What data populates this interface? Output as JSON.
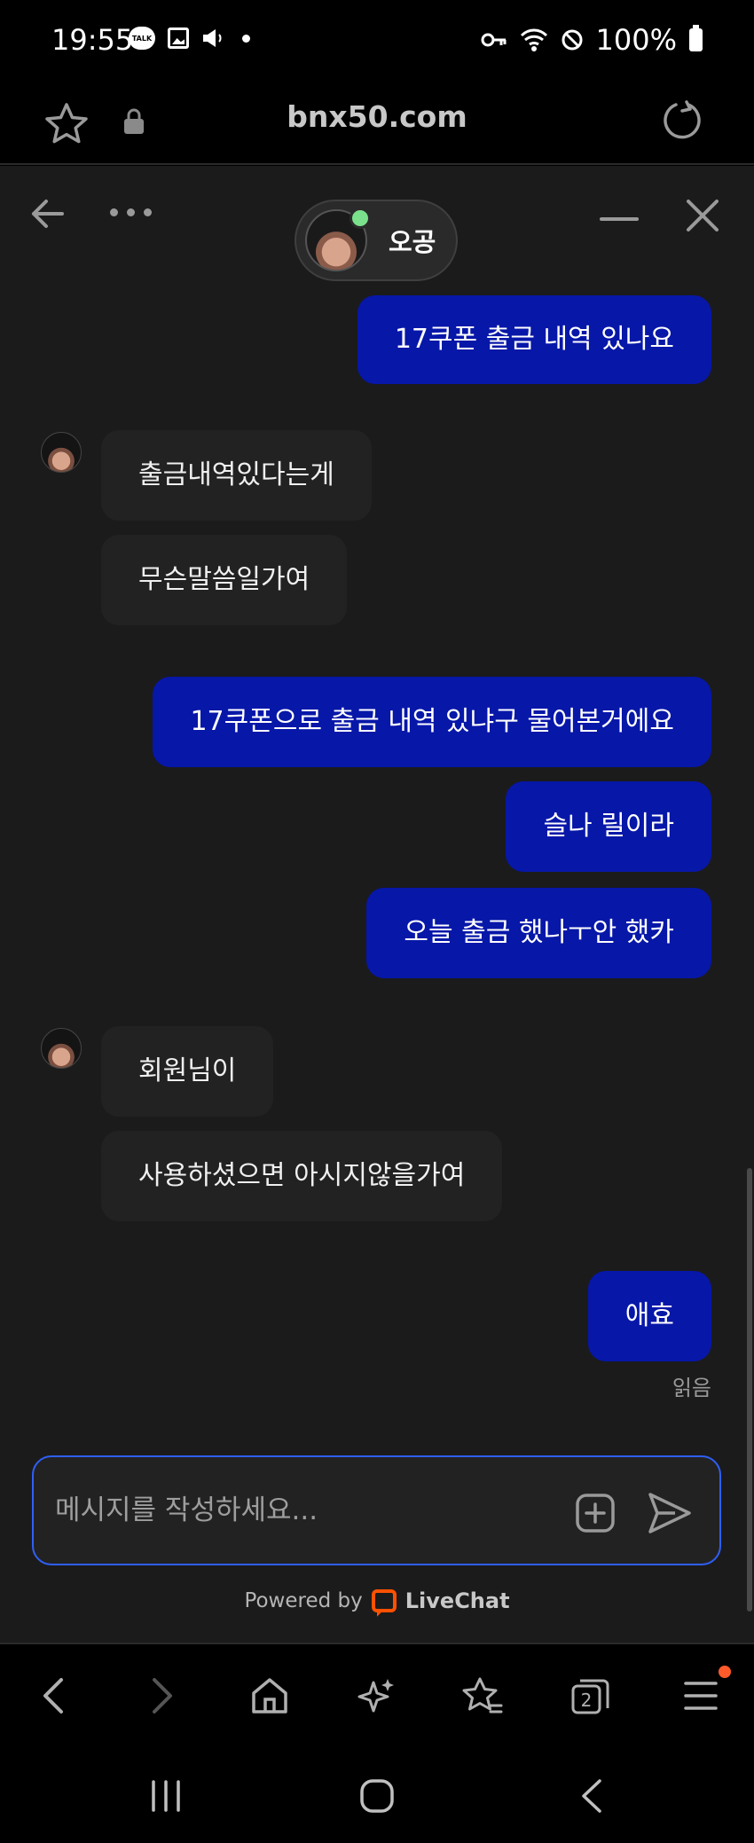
{
  "status_bar": {
    "time": "19:55",
    "talk_badge": "TALK",
    "battery": "100%"
  },
  "browser": {
    "url": "bnx50.com"
  },
  "chat": {
    "agent_name": "오공",
    "messages": [
      {
        "side": "out",
        "text": "17쿠폰 출금 내역 있나요"
      },
      {
        "side": "in",
        "text": "출금내역있다는게"
      },
      {
        "side": "in",
        "text": "무슨말씀일가여"
      },
      {
        "side": "out",
        "text": "17쿠폰으로 출금 내역 있냐구 물어본거에요"
      },
      {
        "side": "out",
        "text": "슬나 릴이라"
      },
      {
        "side": "out",
        "text": "오늘 출금 했나ㅜ안 했카"
      },
      {
        "side": "in",
        "text": "회원님이"
      },
      {
        "side": "in",
        "text": "사용하셨으면 아시지않을가여"
      },
      {
        "side": "out",
        "text": "애효"
      }
    ],
    "read_receipt": "읽음",
    "composer_placeholder": "메시지를 작성하세요...",
    "powered_by": "Powered by",
    "brand": "LiveChat"
  },
  "colors": {
    "outgoing_bubble": "#0717a8",
    "incoming_bubble": "#222223",
    "chat_bg": "#1b1b1c",
    "composer_border": "#2f5ff5",
    "online": "#7be08b",
    "brand_orange": "#ff5100"
  },
  "icons": {
    "browser_bar": [
      "star-icon",
      "lock-icon",
      "reload-icon"
    ],
    "browser_nav": [
      "back-arrow-icon",
      "forward-arrow-icon",
      "home-icon",
      "sparkle-icon",
      "bookmarks-icon",
      "tabs-icon",
      "menu-icon"
    ],
    "system_nav": [
      "recents-icon",
      "home-icon",
      "back-icon"
    ]
  },
  "tabs_count": "2"
}
